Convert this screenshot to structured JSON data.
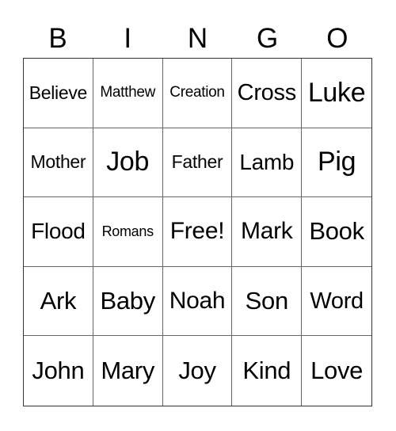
{
  "card": {
    "header": [
      "B",
      "I",
      "N",
      "G",
      "O"
    ],
    "rows": [
      [
        {
          "text": "Believe",
          "size": 23
        },
        {
          "text": "Matthew",
          "size": 19
        },
        {
          "text": "Creation",
          "size": 19
        },
        {
          "text": "Cross",
          "size": 29
        },
        {
          "text": "Luke",
          "size": 34
        }
      ],
      [
        {
          "text": "Mother",
          "size": 23
        },
        {
          "text": "Job",
          "size": 34
        },
        {
          "text": "Father",
          "size": 23
        },
        {
          "text": "Lamb",
          "size": 28
        },
        {
          "text": "Pig",
          "size": 34
        }
      ],
      [
        {
          "text": "Flood",
          "size": 28
        },
        {
          "text": "Romans",
          "size": 18
        },
        {
          "text": "Free!",
          "size": 30
        },
        {
          "text": "Mark",
          "size": 30
        },
        {
          "text": "Book",
          "size": 31
        }
      ],
      [
        {
          "text": "Ark",
          "size": 31
        },
        {
          "text": "Baby",
          "size": 31
        },
        {
          "text": "Noah",
          "size": 30
        },
        {
          "text": "Son",
          "size": 31
        },
        {
          "text": "Word",
          "size": 29
        }
      ],
      [
        {
          "text": "John",
          "size": 31
        },
        {
          "text": "Mary",
          "size": 31
        },
        {
          "text": "Joy",
          "size": 31
        },
        {
          "text": "Kind",
          "size": 31
        },
        {
          "text": "Love",
          "size": 31
        }
      ]
    ]
  }
}
